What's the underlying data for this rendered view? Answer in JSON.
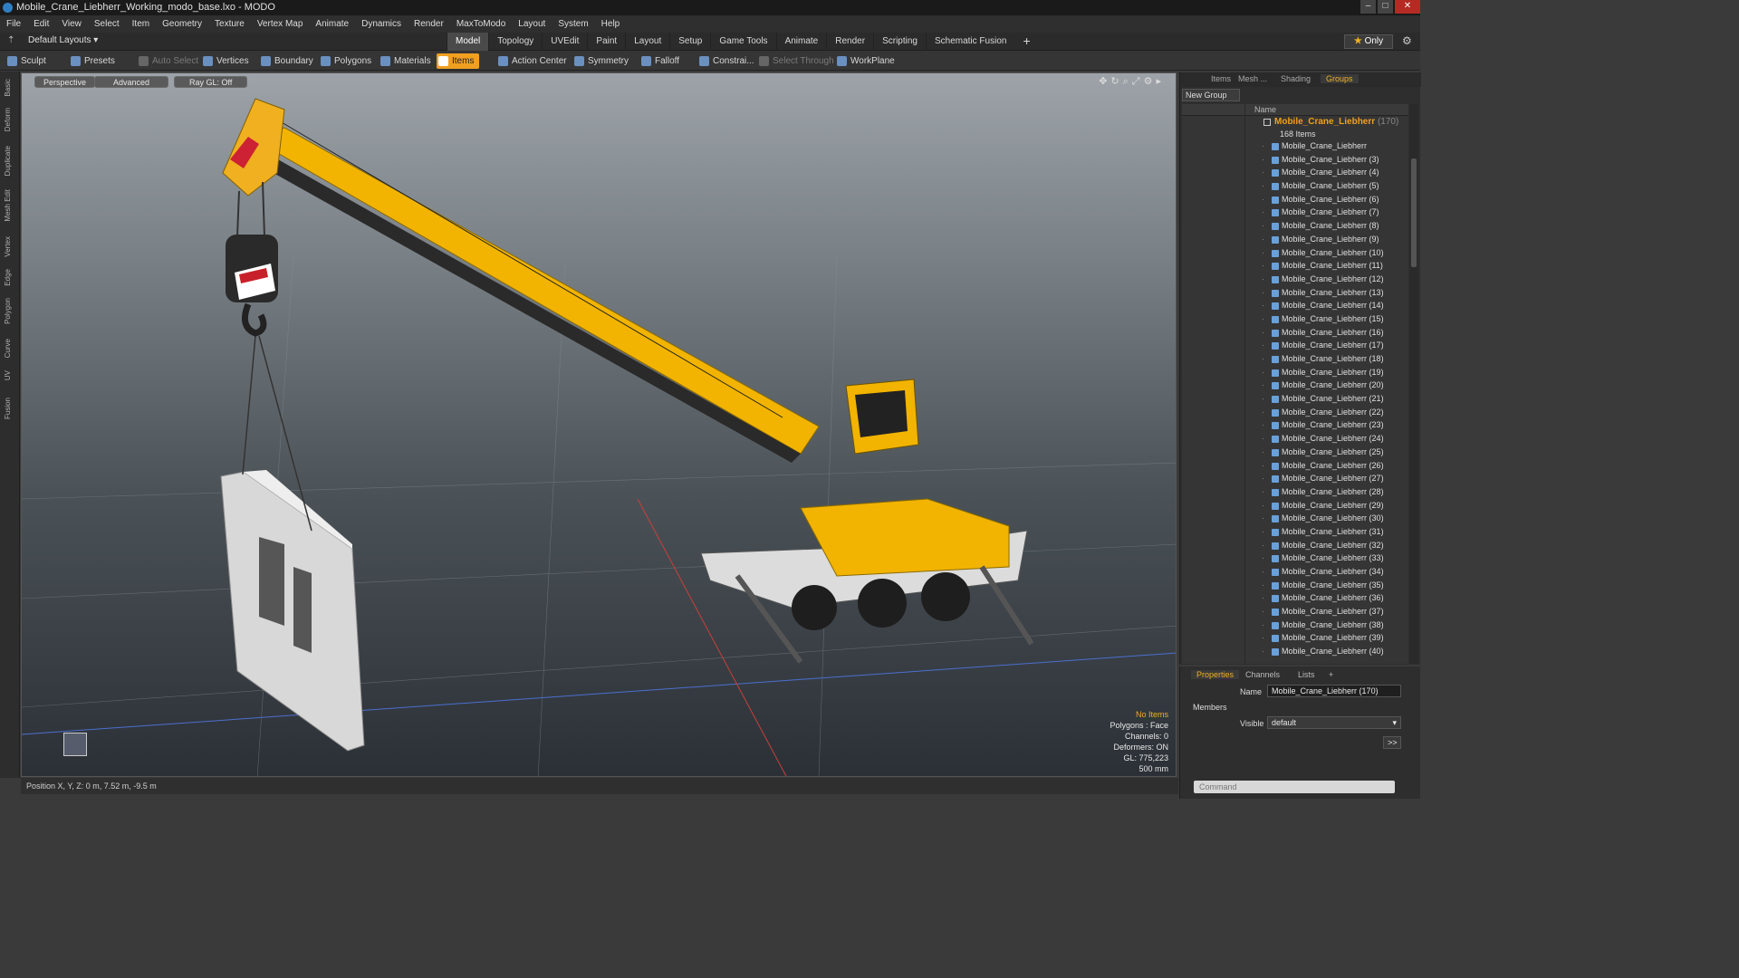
{
  "window": {
    "title": "Mobile_Crane_Liebherr_Working_modo_base.lxo - MODO"
  },
  "menu": [
    "File",
    "Edit",
    "View",
    "Select",
    "Item",
    "Geometry",
    "Texture",
    "Vertex Map",
    "Animate",
    "Dynamics",
    "Render",
    "MaxToModo",
    "Layout",
    "System",
    "Help"
  ],
  "layoutbar": {
    "default_layouts": "Default Layouts ▾",
    "tabs": [
      "Model",
      "Topology",
      "UVEdit",
      "Paint",
      "Layout",
      "Setup",
      "Game Tools",
      "Animate",
      "Render",
      "Scripting",
      "Schematic Fusion"
    ],
    "active_tab": "Model",
    "only": "Only"
  },
  "toolbar": {
    "sculpt": "Sculpt",
    "presets": "Presets",
    "auto_select": "Auto Select",
    "vertices": "Vertices",
    "boundary": "Boundary",
    "polygons": "Polygons",
    "materials": "Materials",
    "items": "Items",
    "action_center": "Action Center",
    "symmetry": "Symmetry",
    "falloff": "Falloff",
    "constraints": "Constrai...",
    "select_through": "Select Through",
    "workplane": "WorkPlane"
  },
  "left_tabs": [
    "Basic",
    "Deform",
    "Duplicate",
    "Mesh Edit",
    "Vertex",
    "Edge",
    "Polygon",
    "Curve",
    "UV",
    "Fusion"
  ],
  "viewport": {
    "perspective": "Perspective",
    "advanced": "Advanced",
    "raygl": "Ray GL: Off",
    "hud": {
      "items": "No Items",
      "polygons": "Polygons : Face",
      "channels": "Channels: 0",
      "deformers": "Deformers: ON",
      "gl": "GL: 775,223",
      "scale": "500 mm"
    }
  },
  "status": "Position X, Y, Z:  0 m, 7.52 m, -9.5 m",
  "right_panel": {
    "tabs": [
      "Items",
      "Mesh ...",
      "Shading",
      "Groups"
    ],
    "active_tab": "Groups",
    "new_group": "New Group",
    "name_header": "Name",
    "root_name": "Mobile_Crane_Liebherr",
    "root_count": "(170)",
    "root_sub": "168 Items",
    "items": [
      "Mobile_Crane_Liebherr",
      "Mobile_Crane_Liebherr (3)",
      "Mobile_Crane_Liebherr (4)",
      "Mobile_Crane_Liebherr (5)",
      "Mobile_Crane_Liebherr (6)",
      "Mobile_Crane_Liebherr (7)",
      "Mobile_Crane_Liebherr (8)",
      "Mobile_Crane_Liebherr (9)",
      "Mobile_Crane_Liebherr (10)",
      "Mobile_Crane_Liebherr (11)",
      "Mobile_Crane_Liebherr (12)",
      "Mobile_Crane_Liebherr (13)",
      "Mobile_Crane_Liebherr (14)",
      "Mobile_Crane_Liebherr (15)",
      "Mobile_Crane_Liebherr (16)",
      "Mobile_Crane_Liebherr (17)",
      "Mobile_Crane_Liebherr (18)",
      "Mobile_Crane_Liebherr (19)",
      "Mobile_Crane_Liebherr (20)",
      "Mobile_Crane_Liebherr (21)",
      "Mobile_Crane_Liebherr (22)",
      "Mobile_Crane_Liebherr (23)",
      "Mobile_Crane_Liebherr (24)",
      "Mobile_Crane_Liebherr (25)",
      "Mobile_Crane_Liebherr (26)",
      "Mobile_Crane_Liebherr (27)",
      "Mobile_Crane_Liebherr (28)",
      "Mobile_Crane_Liebherr (29)",
      "Mobile_Crane_Liebherr (30)",
      "Mobile_Crane_Liebherr (31)",
      "Mobile_Crane_Liebherr (32)",
      "Mobile_Crane_Liebherr (33)",
      "Mobile_Crane_Liebherr (34)",
      "Mobile_Crane_Liebherr (35)",
      "Mobile_Crane_Liebherr (36)",
      "Mobile_Crane_Liebherr (37)",
      "Mobile_Crane_Liebherr (38)",
      "Mobile_Crane_Liebherr (39)",
      "Mobile_Crane_Liebherr (40)"
    ]
  },
  "properties": {
    "tabs": [
      "Properties",
      "Channels",
      "Lists",
      "+"
    ],
    "name_label": "Name",
    "name_value": "Mobile_Crane_Liebherr (170)",
    "members": "Members",
    "visible_label": "Visible",
    "visible_value": "default",
    "more": ">>"
  },
  "command": {
    "placeholder": "Command"
  },
  "colors": {
    "accent": "#f0a020",
    "crane_yellow": "#f2b400"
  }
}
